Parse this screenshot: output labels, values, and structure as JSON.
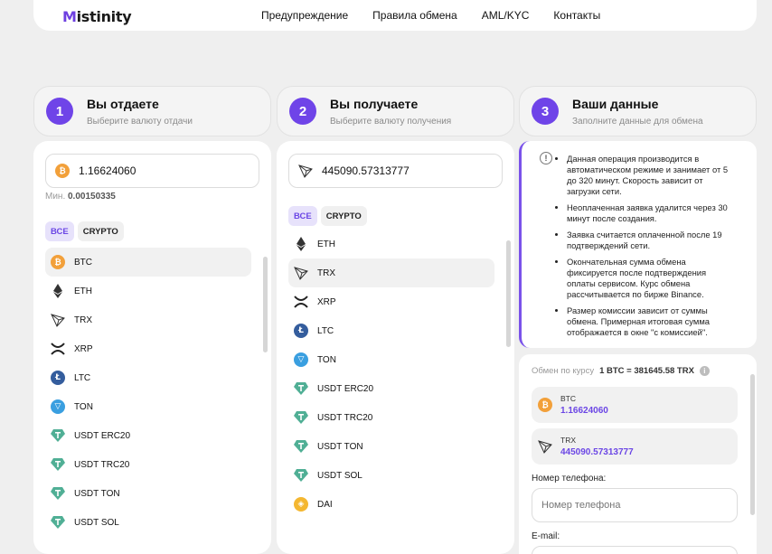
{
  "header": {
    "logo_first": "M",
    "logo_rest": "istinity",
    "nav": [
      "Предупреждение",
      "Правила обмена",
      "AML/KYC",
      "Контакты"
    ]
  },
  "steps": [
    {
      "num": "1",
      "title": "Вы отдаете",
      "subtitle": "Выберите валюту отдачи"
    },
    {
      "num": "2",
      "title": "Вы получаете",
      "subtitle": "Выберите валюту получения"
    },
    {
      "num": "3",
      "title": "Ваши данные",
      "subtitle": "Заполните данные для обмена"
    }
  ],
  "give": {
    "amount": "1.16624060",
    "min_label": "Мин.",
    "min_value": "0.00150335",
    "filters": [
      "ВСЕ",
      "CRYPTO"
    ],
    "items": [
      "BTC",
      "ETH",
      "TRX",
      "XRP",
      "LTC",
      "TON",
      "USDT ERC20",
      "USDT TRC20",
      "USDT TON",
      "USDT SOL"
    ]
  },
  "receive": {
    "amount": "445090.57313777",
    "filters": [
      "ВСЕ",
      "CRYPTO"
    ],
    "items": [
      "ETH",
      "TRX",
      "XRP",
      "LTC",
      "TON",
      "USDT ERC20",
      "USDT TRC20",
      "USDT TON",
      "USDT SOL",
      "DAI"
    ]
  },
  "info": {
    "icon": "!",
    "items": [
      "Данная операция производится в автоматическом режиме и занимает от 5 до 320 минут. Скорость зависит от загрузки сети.",
      "Неоплаченная заявка удалится через 30 минут после создания.",
      "Заявка считается оплаченной после 19 подтверждений сети.",
      "Окончательная сумма обмена фиксируется после подтверждения оплаты сервисом. Курс обмена рассчитывается по бирже Binance.",
      "Размер комиссии зависит от суммы обмена. Примерная итоговая сумма отображается в окне \"с комиссией\"."
    ]
  },
  "summary": {
    "rate_label": "Обмен по курсу",
    "rate_value": "1 BTC = 381645.58 TRX",
    "rate_icon": "i",
    "give_code": "BTC",
    "give_value": "1.16624060",
    "receive_code": "TRX",
    "receive_value": "445090.57313777",
    "phone_label": "Номер телефона:",
    "phone_placeholder": "Номер телефона",
    "email_label": "E-mail:"
  },
  "colors": {
    "accent": "#6f44e8",
    "btc": "#f2a03a",
    "ltc": "#345d9d",
    "ton": "#3a9fe0",
    "usdt": "#50af95",
    "dai": "#f4b731"
  }
}
